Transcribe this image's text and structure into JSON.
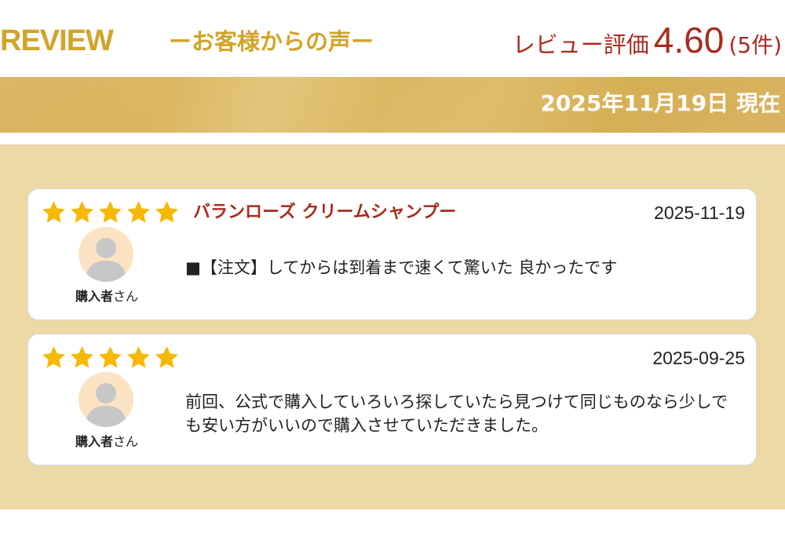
{
  "header": {
    "brand": "REVIEW",
    "subtitle": "ーお客様からの声ー",
    "rating_label": "レビュー評価",
    "rating_score": "4.60",
    "rating_count": "(5件)"
  },
  "date_band": {
    "text": "2025年11月19日 現在"
  },
  "colors": {
    "gold_text": "#d1a42a",
    "rating_red": "#a82b1e",
    "band_gold": "#d9b45a",
    "area_beige": "#ecd9a6",
    "star_gold": "#f6b800",
    "avatar_bg": "#fbe3c4"
  },
  "reviews": [
    {
      "stars": 5,
      "product": "バランローズ クリームシャンプー",
      "date": "2025-11-19",
      "reviewer_name": "購入者",
      "reviewer_suffix": "さん",
      "text": "■【注文】してからは到着まで速くて驚いた 良かったです",
      "avatar_icon": "user-silhouette-icon"
    },
    {
      "stars": 5,
      "product": "",
      "date": "2025-09-25",
      "reviewer_name": "購入者",
      "reviewer_suffix": "さん",
      "text": "前回、公式で購入していろいろ探していたら見つけて同じものなら少しでも安い方がいいので購入させていただきました。",
      "avatar_icon": "user-silhouette-icon"
    }
  ]
}
